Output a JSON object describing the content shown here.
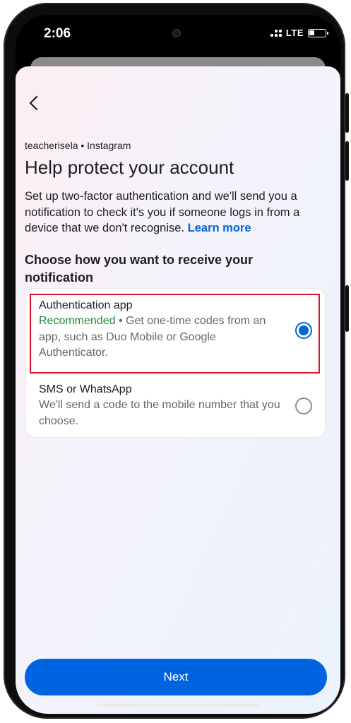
{
  "status_bar": {
    "time": "2:06",
    "network": "LTE"
  },
  "header": {
    "account": "teacherisela • Instagram",
    "title": "Help protect your account",
    "description": "Set up two-factor authentication and we'll send you a notification to check it's you if someone logs in from a device that we don't recognise.",
    "learn_more": "Learn more"
  },
  "section": {
    "heading": "Choose how you want to receive your notification"
  },
  "options": [
    {
      "title": "Authentication app",
      "recommended": "Recommended",
      "description": " • Get one-time codes from an app, such as Duo Mobile or Google Authenticator.",
      "selected": true
    },
    {
      "title": "SMS or WhatsApp",
      "description": "We'll send a code to the mobile number that you choose.",
      "selected": false
    }
  ],
  "footer": {
    "next_label": "Next"
  },
  "colors": {
    "accent": "#0064e0",
    "recommended": "#1e8a3a",
    "highlight": "#e0102c"
  },
  "icons": {
    "back": "chevron-left-icon"
  }
}
